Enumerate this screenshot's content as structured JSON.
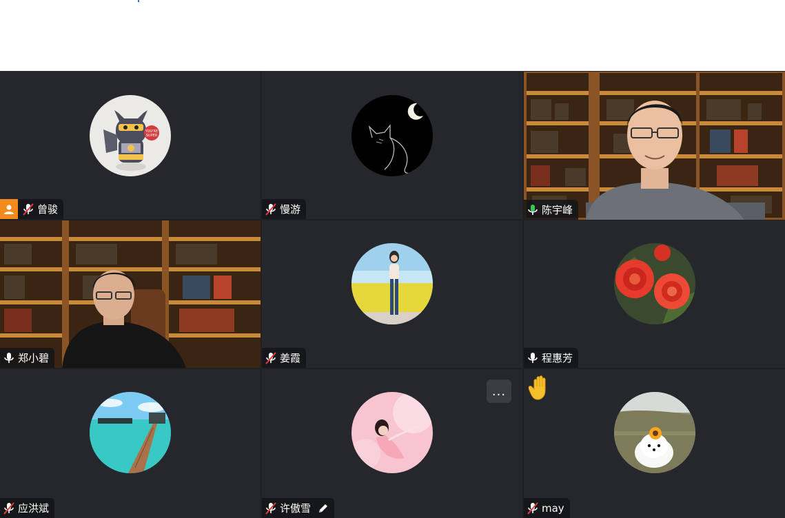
{
  "participants": [
    {
      "name": "曾骏",
      "mic": "muted",
      "host": true,
      "avatar": "cartoon-cat-avatar"
    },
    {
      "name": "慢游",
      "mic": "muted",
      "avatar": "black-cat-moon-avatar"
    },
    {
      "name": "陈宇峰",
      "mic": "speaking",
      "video": "man-with-glasses-bookshelf",
      "active_speaker": true
    },
    {
      "name": "郑小碧",
      "mic": "on",
      "video": "man-in-black-jacket-bookshelf"
    },
    {
      "name": "姜霞",
      "mic": "muted",
      "avatar": "woman-flower-field-avatar"
    },
    {
      "name": "程惠芳",
      "mic": "on",
      "avatar": "red-roses-avatar"
    },
    {
      "name": "应洪斌",
      "mic": "muted",
      "avatar": "tropical-pier-avatar"
    },
    {
      "name": "许傲雪",
      "mic": "muted",
      "avatar": "pink-portrait-avatar",
      "editing_icon": "pencil-icon",
      "more_button": "..."
    },
    {
      "name": "may",
      "mic": "muted",
      "avatar": "white-dog-sunflower-avatar",
      "reaction": "raised-hand-icon"
    }
  ],
  "colors": {
    "grid_bg": "#1f2024",
    "tile_bg": "#25272c",
    "active_border": "#2fcf55",
    "host_badge": "#f28a1c",
    "muted_red": "#e23b3b"
  }
}
